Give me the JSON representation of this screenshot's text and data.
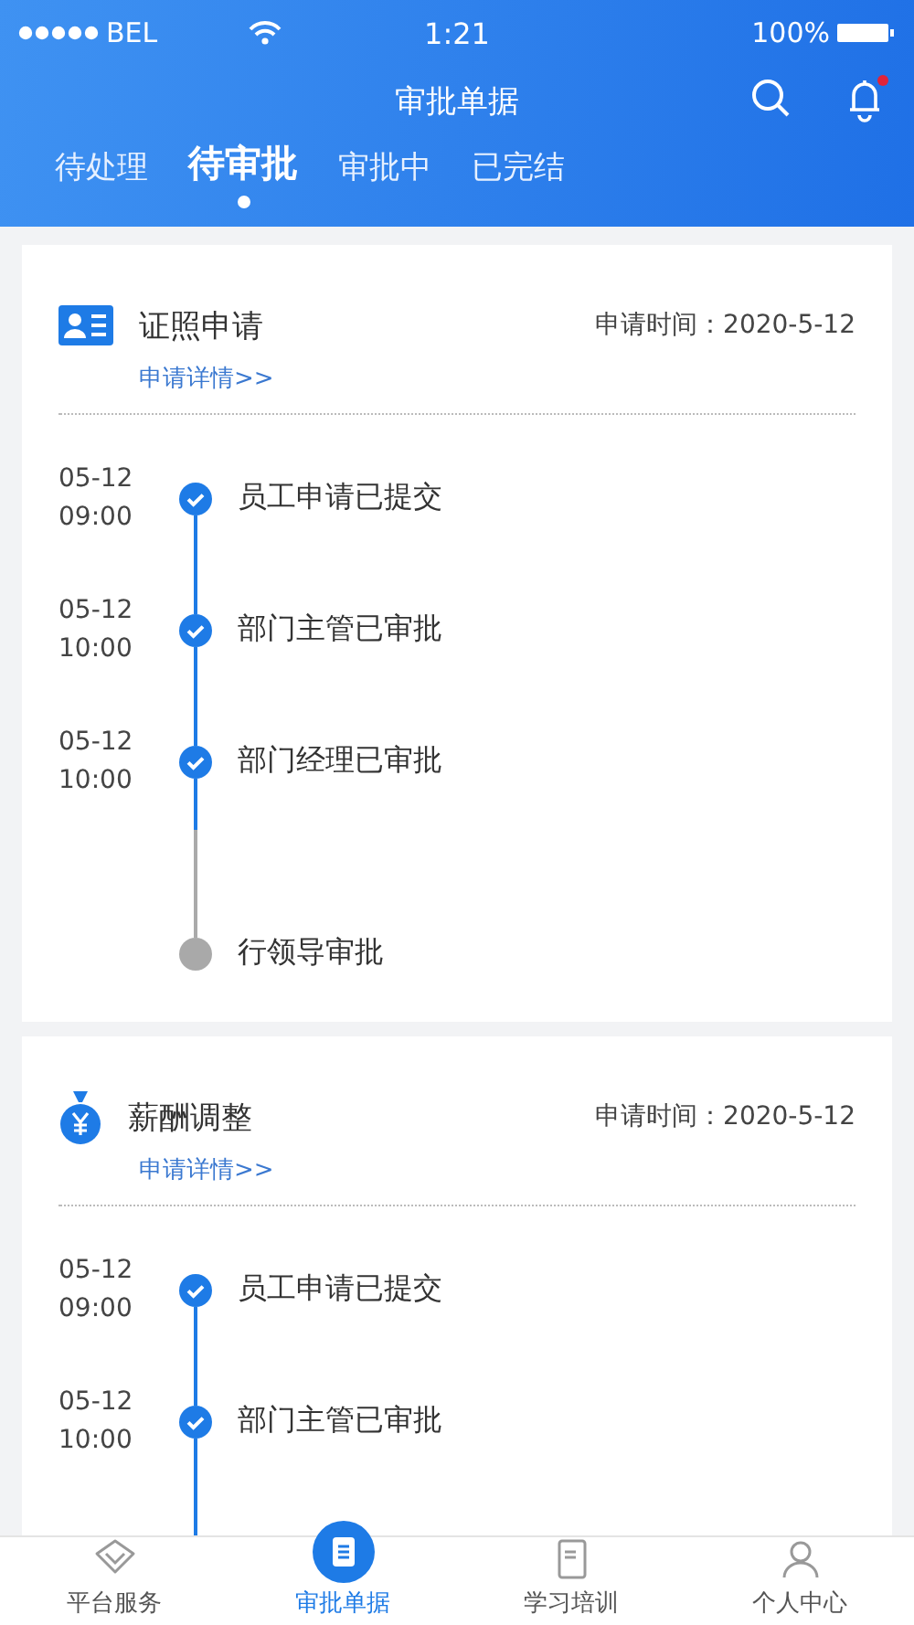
{
  "status_bar": {
    "carrier": "BEL",
    "time": "1:21",
    "battery": "100%"
  },
  "header": {
    "title": "审批单据",
    "notification_dot": true
  },
  "tabs": [
    {
      "label": "待处理",
      "selected": false
    },
    {
      "label": "待审批",
      "selected": true
    },
    {
      "label": "审批中",
      "selected": false
    },
    {
      "label": "已完结",
      "selected": false
    }
  ],
  "cards": [
    {
      "kind": "license",
      "title": "证照申请",
      "time_label": "申请时间：2020-5-12",
      "link": "申请详情>>",
      "continues": false,
      "steps": [
        {
          "date": "05-12",
          "time": "09:00",
          "label": "员工申请已提交",
          "done": true
        },
        {
          "date": "05-12",
          "time": "10:00",
          "label": "部门主管已审批",
          "done": true
        },
        {
          "date": "05-12",
          "time": "10:00",
          "label": "部门经理已审批",
          "done": true
        },
        {
          "label": "行领导审批",
          "done": false
        }
      ]
    },
    {
      "kind": "salary",
      "title": "薪酬调整",
      "time_label": "申请时间：2020-5-12",
      "link": "申请详情>>",
      "continues": true,
      "steps": [
        {
          "date": "05-12",
          "time": "09:00",
          "label": "员工申请已提交",
          "done": true
        },
        {
          "date": "05-12",
          "time": "10:00",
          "label": "部门主管已审批",
          "done": true
        }
      ]
    }
  ],
  "bottom_nav": [
    {
      "kind": "service",
      "label": "平台服务",
      "selected": false
    },
    {
      "kind": "approval",
      "label": "审批单据",
      "selected": true
    },
    {
      "kind": "study",
      "label": "学习培训",
      "selected": false
    },
    {
      "kind": "profile",
      "label": "个人中心",
      "selected": false
    }
  ]
}
